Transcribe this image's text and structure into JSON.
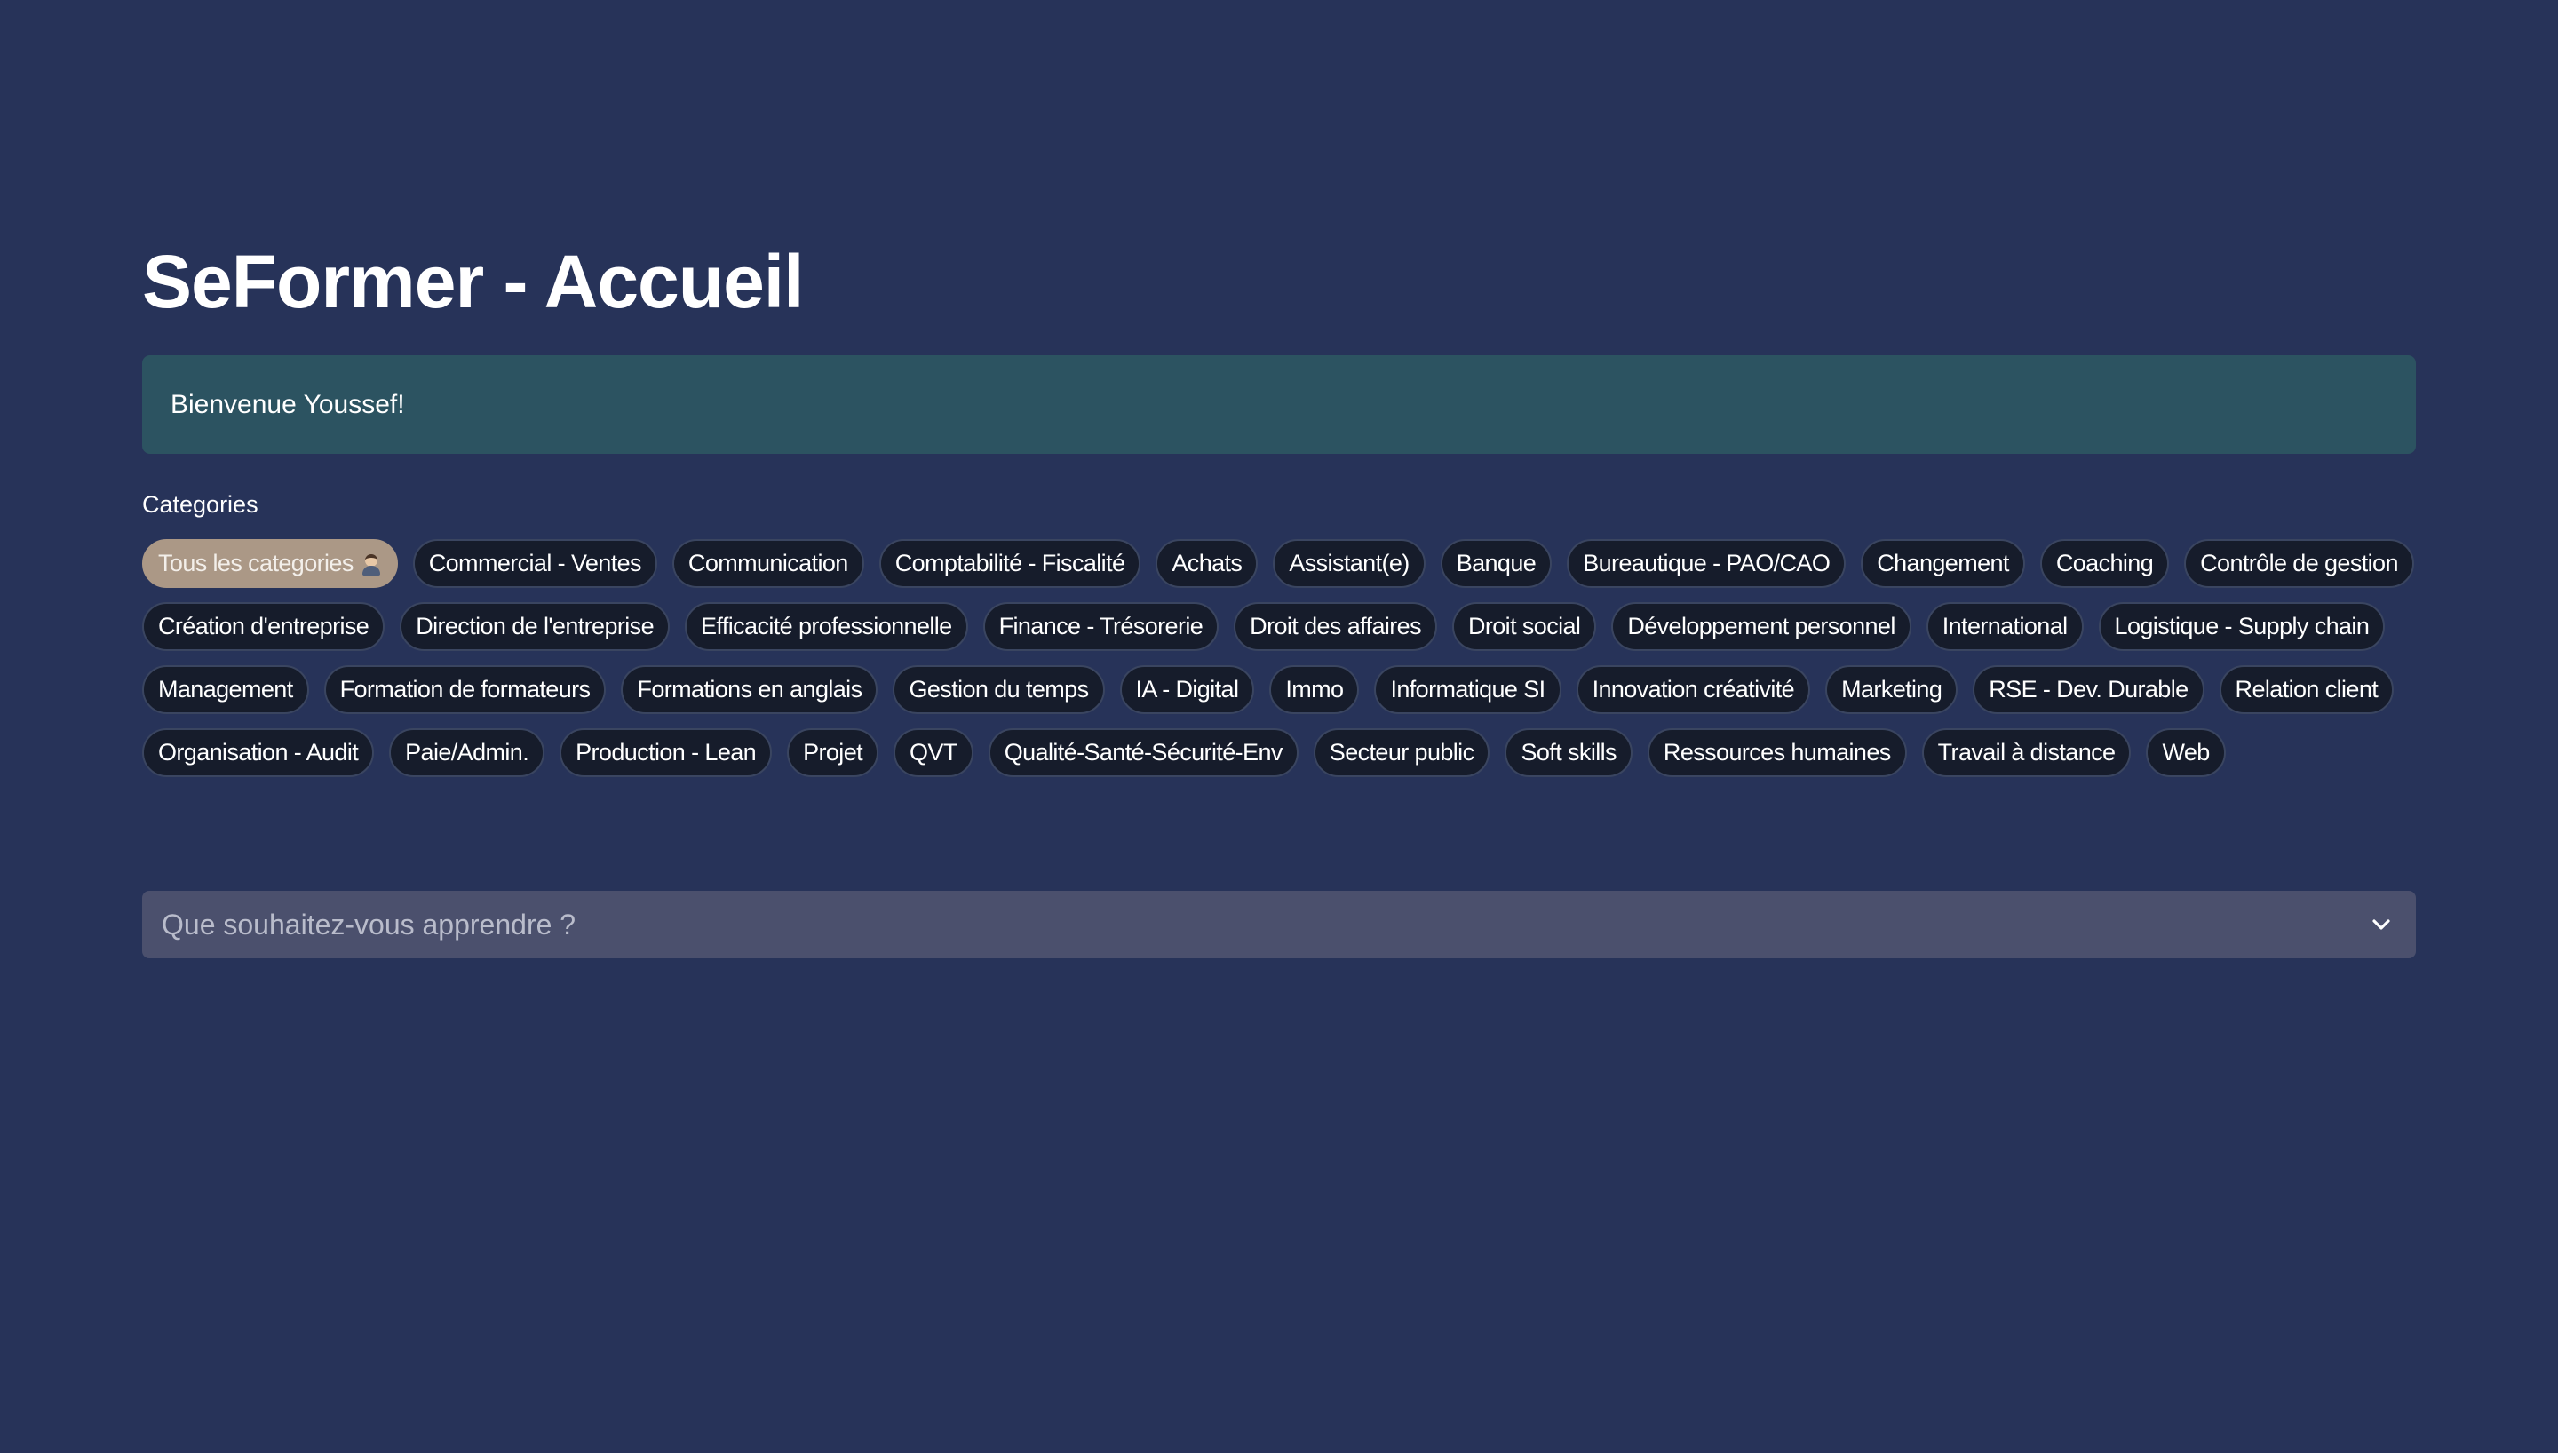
{
  "header": {
    "title": "SeFormer - Accueil"
  },
  "welcome": {
    "message": "Bienvenue Youssef!"
  },
  "categories": {
    "label": "Categories",
    "selected": "Tous les categories",
    "selected_icon": "person-emoji-icon",
    "items": [
      "Tous les categories",
      "Commercial - Ventes",
      "Communication",
      "Comptabilité - Fiscalité",
      "Achats",
      "Assistant(e)",
      "Banque",
      "Bureautique - PAO/CAO",
      "Changement",
      "Coaching",
      "Contrôle de gestion",
      "Création d'entreprise",
      "Direction de l'entreprise",
      "Efficacité professionnelle",
      "Finance - Trésorerie",
      "Droit des affaires",
      "Droit social",
      "Développement personnel",
      "International",
      "Logistique - Supply chain",
      "Management",
      "Formation de formateurs",
      "Formations en anglais",
      "Gestion du temps",
      "IA - Digital",
      "Immo",
      "Informatique SI",
      "Innovation créativité",
      "Marketing",
      "RSE - Dev. Durable",
      "Relation client",
      "Organisation - Audit",
      "Paie/Admin.",
      "Production - Lean",
      "Projet",
      "QVT",
      "Qualité-Santé-Sécurité-Env",
      "Secteur public",
      "Soft skills",
      "Ressources humaines",
      "Travail à distance",
      "Web"
    ]
  },
  "search": {
    "placeholder": "Que souhaitez-vous apprendre ?",
    "value": "",
    "dropdown_icon": "chevron-down-icon"
  },
  "colors": {
    "background": "#273359",
    "welcome_bg": "#2c5361",
    "pill_bg": "#161c2b",
    "pill_selected_bg": "#ab9886",
    "search_bg": "#4b506d"
  }
}
